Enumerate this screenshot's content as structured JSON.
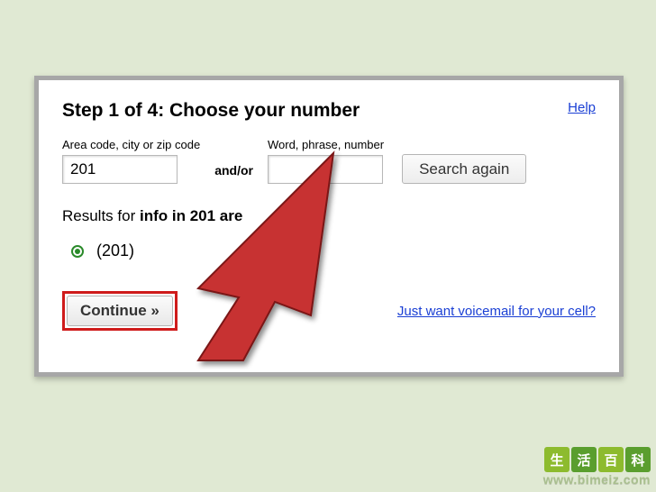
{
  "header": {
    "title": "Step 1 of 4: Choose your number",
    "help": "Help"
  },
  "search": {
    "area_label": "Area code, city or zip code",
    "area_value": "201",
    "andor": "and/or",
    "word_label": "Word, phrase, number",
    "word_value": "",
    "button": "Search again"
  },
  "results": {
    "prefix": "Results for ",
    "bold": "info in 201 are",
    "option": "(201)"
  },
  "actions": {
    "continue": "Continue »",
    "voicemail": "Just want voicemail for your cell?"
  },
  "watermark": {
    "c1": "生",
    "c2": "活",
    "c3": "百",
    "c4": "科",
    "url": "www.bimeiz.com"
  }
}
